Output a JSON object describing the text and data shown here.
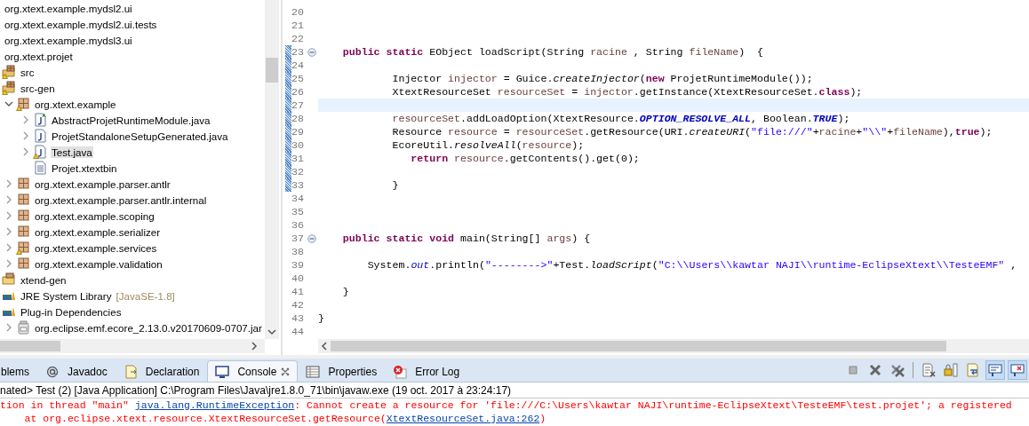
{
  "project_tree": {
    "items": [
      {
        "label": "org.xtext.example.mydsl2.ui"
      },
      {
        "label": "org.xtext.example.mydsl2.ui.tests"
      },
      {
        "label": "org.xtext.example.mydsl3.ui"
      },
      {
        "label": "org.xtext.projet",
        "children": [
          {
            "label": "src",
            "kind": "source-folder",
            "warning": true
          },
          {
            "label": "src-gen",
            "kind": "source-folder",
            "warning": true,
            "children": [
              {
                "label": "org.xtext.example",
                "kind": "package",
                "warning": true,
                "expanded": true,
                "children": [
                  {
                    "label": "AbstractProjetRuntimeModule.java",
                    "kind": "java-abstract",
                    "expanded": false,
                    "selected": false
                  },
                  {
                    "label": "ProjetStandaloneSetupGenerated.java",
                    "kind": "java-file",
                    "expanded": false,
                    "selected": false
                  },
                  {
                    "label": "Test.java",
                    "kind": "java-file",
                    "warning": true,
                    "expanded": false,
                    "selected": true
                  },
                  {
                    "label": "Projet.xtextbin",
                    "kind": "text-file",
                    "selected": false
                  }
                ]
              },
              {
                "label": "org.xtext.example.parser.antlr",
                "kind": "package",
                "expanded": false
              },
              {
                "label": "org.xtext.example.parser.antlr.internal",
                "kind": "package",
                "expanded": false
              },
              {
                "label": "org.xtext.example.scoping",
                "kind": "package",
                "expanded": false
              },
              {
                "label": "org.xtext.example.serializer",
                "kind": "package",
                "expanded": false
              },
              {
                "label": "org.xtext.example.services",
                "kind": "package",
                "warning": true,
                "expanded": false
              },
              {
                "label": "org.xtext.example.validation",
                "kind": "package",
                "expanded": false
              }
            ]
          },
          {
            "label": "xtend-gen",
            "kind": "folder"
          },
          {
            "label": "JRE System Library",
            "decoration": "[JavaSE-1.8]",
            "kind": "library"
          },
          {
            "label": "Plug-in Dependencies",
            "kind": "library",
            "children": [
              {
                "label": "org.eclipse.emf.ecore_2.13.0.v20170609-0707.jar",
                "kind": "jar",
                "expanded": false
              }
            ]
          }
        ]
      }
    ]
  },
  "editor": {
    "lines": [
      {
        "number": "20"
      },
      {
        "number": "21"
      },
      {
        "number": "22"
      },
      {
        "number": "23",
        "changed": true,
        "fold": true,
        "tokens": [
          {
            "text": "    public static",
            "kind": "keyword"
          },
          {
            "text": " EObject loadScript(String ",
            "kind": "plain"
          },
          {
            "text": "racine",
            "kind": "local"
          },
          {
            "text": " , String ",
            "kind": "plain"
          },
          {
            "text": "fileName",
            "kind": "local"
          },
          {
            "text": ")  {",
            "kind": "plain"
          }
        ]
      },
      {
        "number": "24",
        "changed": true
      },
      {
        "number": "25",
        "changed": true,
        "tokens": [
          {
            "text": "            Injector ",
            "kind": "plain"
          },
          {
            "text": "injector",
            "kind": "local"
          },
          {
            "text": " = Guice.",
            "kind": "plain"
          },
          {
            "text": "createInjector",
            "kind": "static"
          },
          {
            "text": "(",
            "kind": "plain"
          },
          {
            "text": "new",
            "kind": "keyword"
          },
          {
            "text": " ProjetRuntimeModule());",
            "kind": "plain"
          }
        ]
      },
      {
        "number": "26",
        "changed": true,
        "tokens": [
          {
            "text": "            XtextResourceSet ",
            "kind": "plain"
          },
          {
            "text": "resourceSet",
            "kind": "local"
          },
          {
            "text": " = ",
            "kind": "plain"
          },
          {
            "text": "injector",
            "kind": "local"
          },
          {
            "text": ".getInstance(XtextResourceSet.",
            "kind": "plain"
          },
          {
            "text": "class",
            "kind": "keyword"
          },
          {
            "text": ");",
            "kind": "plain"
          }
        ]
      },
      {
        "number": "27",
        "changed": true,
        "current": true
      },
      {
        "number": "28",
        "changed": true,
        "tokens": [
          {
            "text": "            resourceSet",
            "kind": "local"
          },
          {
            "text": ".addLoadOption(XtextResource.",
            "kind": "plain"
          },
          {
            "text": "OPTION_RESOLVE_ALL",
            "kind": "constant"
          },
          {
            "text": ", Boolean.",
            "kind": "plain"
          },
          {
            "text": "TRUE",
            "kind": "constant"
          },
          {
            "text": ");",
            "kind": "plain"
          }
        ]
      },
      {
        "number": "29",
        "changed": true,
        "tokens": [
          {
            "text": "            Resource ",
            "kind": "plain"
          },
          {
            "text": "resource",
            "kind": "local"
          },
          {
            "text": " = ",
            "kind": "plain"
          },
          {
            "text": "resourceSet",
            "kind": "local"
          },
          {
            "text": ".getResource(URI.",
            "kind": "plain"
          },
          {
            "text": "createURI",
            "kind": "static"
          },
          {
            "text": "(",
            "kind": "plain"
          },
          {
            "text": "\"file:///\"",
            "kind": "string"
          },
          {
            "text": "+",
            "kind": "plain"
          },
          {
            "text": "racine",
            "kind": "local"
          },
          {
            "text": "+",
            "kind": "plain"
          },
          {
            "text": "\"\\\\\"",
            "kind": "string"
          },
          {
            "text": "+",
            "kind": "plain"
          },
          {
            "text": "fileName",
            "kind": "local"
          },
          {
            "text": "),",
            "kind": "plain"
          },
          {
            "text": "true",
            "kind": "keyword"
          },
          {
            "text": ");",
            "kind": "plain"
          }
        ]
      },
      {
        "number": "30",
        "changed": true,
        "tokens": [
          {
            "text": "            EcoreUtil.",
            "kind": "plain"
          },
          {
            "text": "resolveAll",
            "kind": "static"
          },
          {
            "text": "(",
            "kind": "plain"
          },
          {
            "text": "resource",
            "kind": "local"
          },
          {
            "text": ");",
            "kind": "plain"
          }
        ]
      },
      {
        "number": "31",
        "changed": true,
        "tokens": [
          {
            "text": "               return ",
            "kind": "keyword"
          },
          {
            "text": "resource",
            "kind": "local"
          },
          {
            "text": ".getContents().get(0);",
            "kind": "plain"
          }
        ]
      },
      {
        "number": "32",
        "changed": true
      },
      {
        "number": "33",
        "changed": true,
        "tokens": [
          {
            "text": "            }",
            "kind": "plain"
          }
        ]
      },
      {
        "number": "34"
      },
      {
        "number": "35"
      },
      {
        "number": "36"
      },
      {
        "number": "37",
        "fold": true,
        "tokens": [
          {
            "text": "    public static void",
            "kind": "keyword"
          },
          {
            "text": " main(String[] ",
            "kind": "plain"
          },
          {
            "text": "args",
            "kind": "local"
          },
          {
            "text": ") {",
            "kind": "plain"
          }
        ]
      },
      {
        "number": "38"
      },
      {
        "number": "39",
        "tokens": [
          {
            "text": "        System.",
            "kind": "plain"
          },
          {
            "text": "out",
            "kind": "field"
          },
          {
            "text": ".println(",
            "kind": "plain"
          },
          {
            "text": "\"-------->\"",
            "kind": "string"
          },
          {
            "text": "+Test.",
            "kind": "plain"
          },
          {
            "text": "loadScript",
            "kind": "static"
          },
          {
            "text": "(",
            "kind": "plain"
          },
          {
            "text": "\"C:\\\\Users\\\\kawtar NAJI\\\\runtime-EclipseXtext\\\\TesteEMF\"",
            "kind": "string"
          },
          {
            "text": " ,",
            "kind": "plain"
          }
        ]
      },
      {
        "number": "40"
      },
      {
        "number": "41",
        "tokens": [
          {
            "text": "    }",
            "kind": "plain"
          }
        ]
      },
      {
        "number": "42"
      },
      {
        "number": "43",
        "tokens": [
          {
            "text": "}",
            "kind": "plain"
          }
        ]
      },
      {
        "number": "44"
      }
    ]
  },
  "bottom_panel": {
    "tabs": [
      {
        "label": "blems",
        "selected": false
      },
      {
        "label": "Javadoc",
        "selected": false
      },
      {
        "label": "Declaration",
        "selected": false
      },
      {
        "label": "Console",
        "selected": true,
        "closable": true
      },
      {
        "label": "Properties",
        "selected": false
      },
      {
        "label": "Error Log",
        "selected": false
      }
    ],
    "toolbar": [
      {
        "pressed": false
      },
      {
        "pressed": false
      },
      {
        "pressed": false
      },
      {
        "pressed": false
      },
      {
        "pressed": false
      },
      {
        "pressed": false
      },
      {
        "pressed": true
      },
      {
        "pressed": true
      }
    ],
    "console": {
      "header": "nated> Test (2) [Java Application] C:\\Program Files\\Java\\jre1.8.0_71\\bin\\javaw.exe (19 oct. 2017 à 23:24:17)",
      "lines": [
        [
          {
            "text": "tion in thread \"main\" ",
            "kind": "error"
          },
          {
            "text": "java.lang.RuntimeException",
            "kind": "link"
          },
          {
            "text": ": Cannot create a resource for 'file:///C:\\Users\\kawtar NAJI\\runtime-EclipseXtext\\TesteEMF\\test.projet'; a registered",
            "kind": "error"
          }
        ],
        [
          {
            "text": "    at org.eclipse.xtext.resource.XtextResourceSet.getResource(",
            "kind": "error"
          },
          {
            "text": "XtextResourceSet.java:262",
            "kind": "link"
          },
          {
            "text": ")",
            "kind": "error"
          }
        ]
      ]
    }
  }
}
